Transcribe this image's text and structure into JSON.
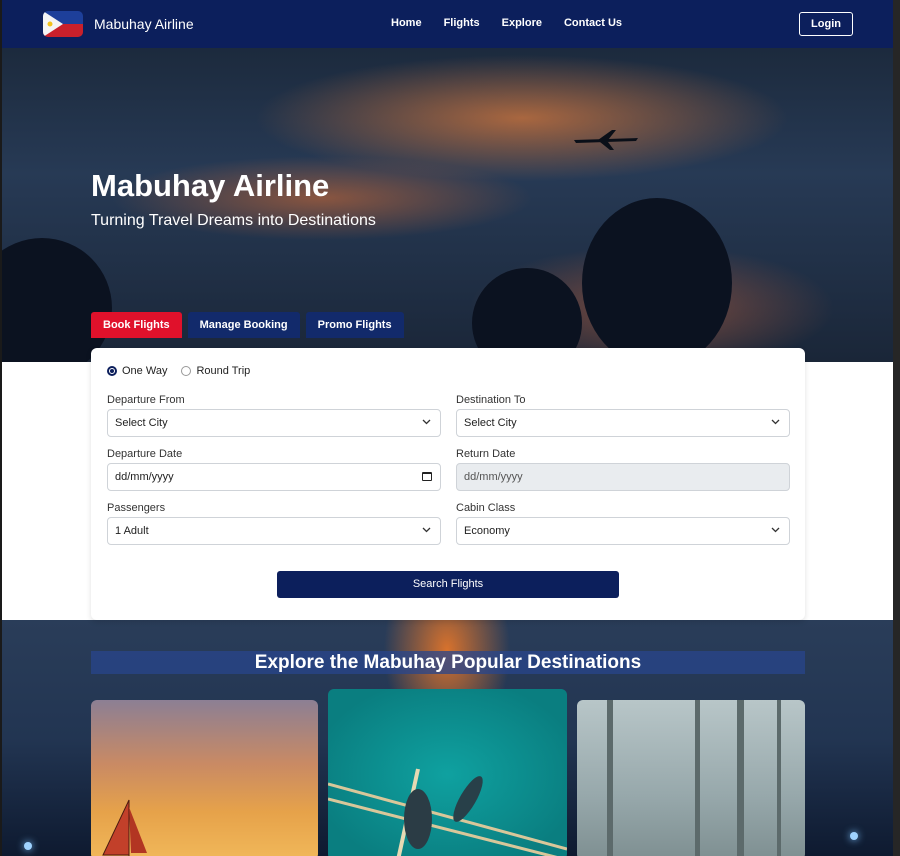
{
  "brand": {
    "name": "Mabuhay Airline"
  },
  "nav": {
    "links": [
      "Home",
      "Flights",
      "Explore",
      "Contact Us"
    ],
    "login": "Login"
  },
  "hero": {
    "title": "Mabuhay Airline",
    "subtitle": "Turning Travel Dreams into Destinations",
    "tabs": [
      "Book Flights",
      "Manage Booking",
      "Promo Flights"
    ]
  },
  "form": {
    "trip_types": [
      "One Way",
      "Round Trip"
    ],
    "departure_from": {
      "label": "Departure From",
      "value": "Select City"
    },
    "destination_to": {
      "label": "Destination To",
      "value": "Select City"
    },
    "departure_date": {
      "label": "Departure Date",
      "value": "dd/mm/yyyy"
    },
    "return_date": {
      "label": "Return Date",
      "value": "dd/mm/yyyy"
    },
    "passengers": {
      "label": "Passengers",
      "value": "1 Adult"
    },
    "cabin_class": {
      "label": "Cabin Class",
      "value": "Economy"
    },
    "search_button": "Search Flights"
  },
  "explore": {
    "title": "Explore the Mabuhay Popular Destinations"
  },
  "colors": {
    "navy": "#0c1f5c",
    "accent_red": "#e0112b"
  }
}
